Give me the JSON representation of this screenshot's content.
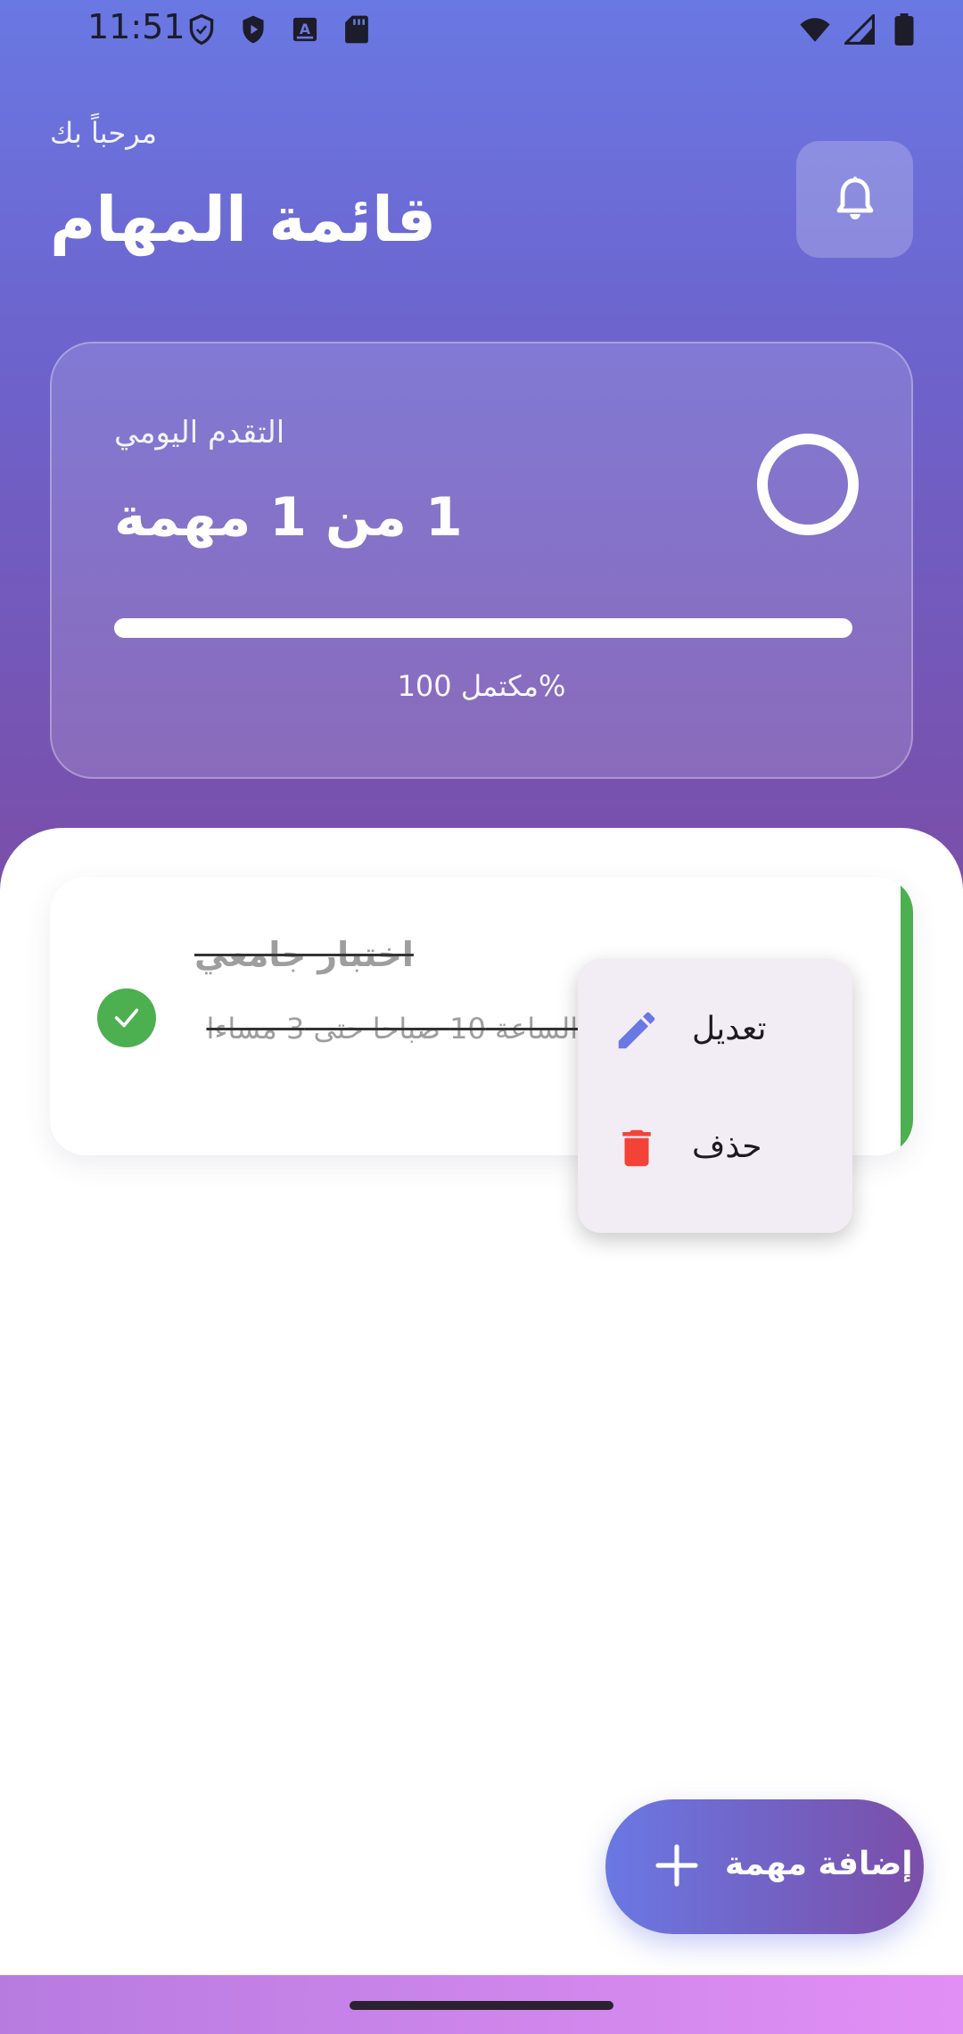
{
  "status_bar": {
    "time": "11:51",
    "left_icons": [
      "shield-outline-icon",
      "shield-play-icon",
      "keyboard-a-icon",
      "sd-card-icon"
    ],
    "right_icons": [
      "wifi-icon",
      "cellular-signal-icon",
      "battery-icon"
    ]
  },
  "header": {
    "greeting": "مرحباً بك",
    "title": "قائمة المهام",
    "bell_icon": "bell-icon"
  },
  "progress": {
    "label": "التقدم اليومي",
    "count_text": "1 من 1 مهمة",
    "fraction": 1.0,
    "percent_text": "مكتمل 100%"
  },
  "tasks": [
    {
      "title": "اختبار جامعي",
      "description": "اختبار اليوم من الساعة 10 صباحا حتى 3 مساءا",
      "completed": true,
      "accent_color": "#4caf50"
    }
  ],
  "context_menu": {
    "edit_label": "تعديل",
    "delete_label": "حذف",
    "edit_icon_color": "#6a78e3",
    "delete_icon_color": "#f44336"
  },
  "fab": {
    "label": "إضافة مهمة"
  },
  "colors": {
    "gradient_start": "#6a78e3",
    "gradient_end": "#7a4ea8",
    "success": "#4caf50",
    "danger": "#f44336"
  }
}
